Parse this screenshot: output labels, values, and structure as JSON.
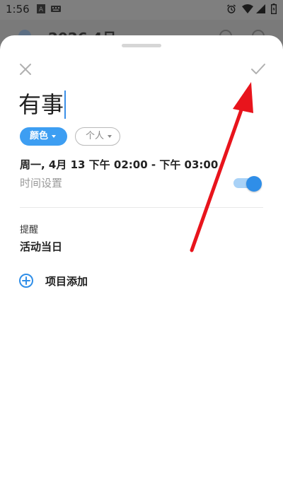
{
  "status_bar": {
    "time": "1:56",
    "icons": [
      "a-icon",
      "keyboard-icon",
      "alarm-icon",
      "wifi-icon",
      "signal-icon",
      "battery-icon"
    ]
  },
  "background_app": {
    "header_title": "2026 4月"
  },
  "event_sheet": {
    "close_icon": "close-icon",
    "confirm_icon": "checkmark-icon",
    "title": "有事",
    "color_chip_label": "颜色",
    "calendar_chip_label": "个人",
    "datetime_text": "周一, 4月 13 下午 02:00 - 下午 03:00",
    "time_setting_label": "时间设置",
    "time_setting_enabled": true,
    "reminder_label": "提醒",
    "reminder_value": "活动当日",
    "add_item_label": "项目添加",
    "colors": {
      "accent": "#3d9ef2",
      "toggle_knob": "#2f8ee8",
      "annotation_arrow": "#e8141c"
    }
  }
}
